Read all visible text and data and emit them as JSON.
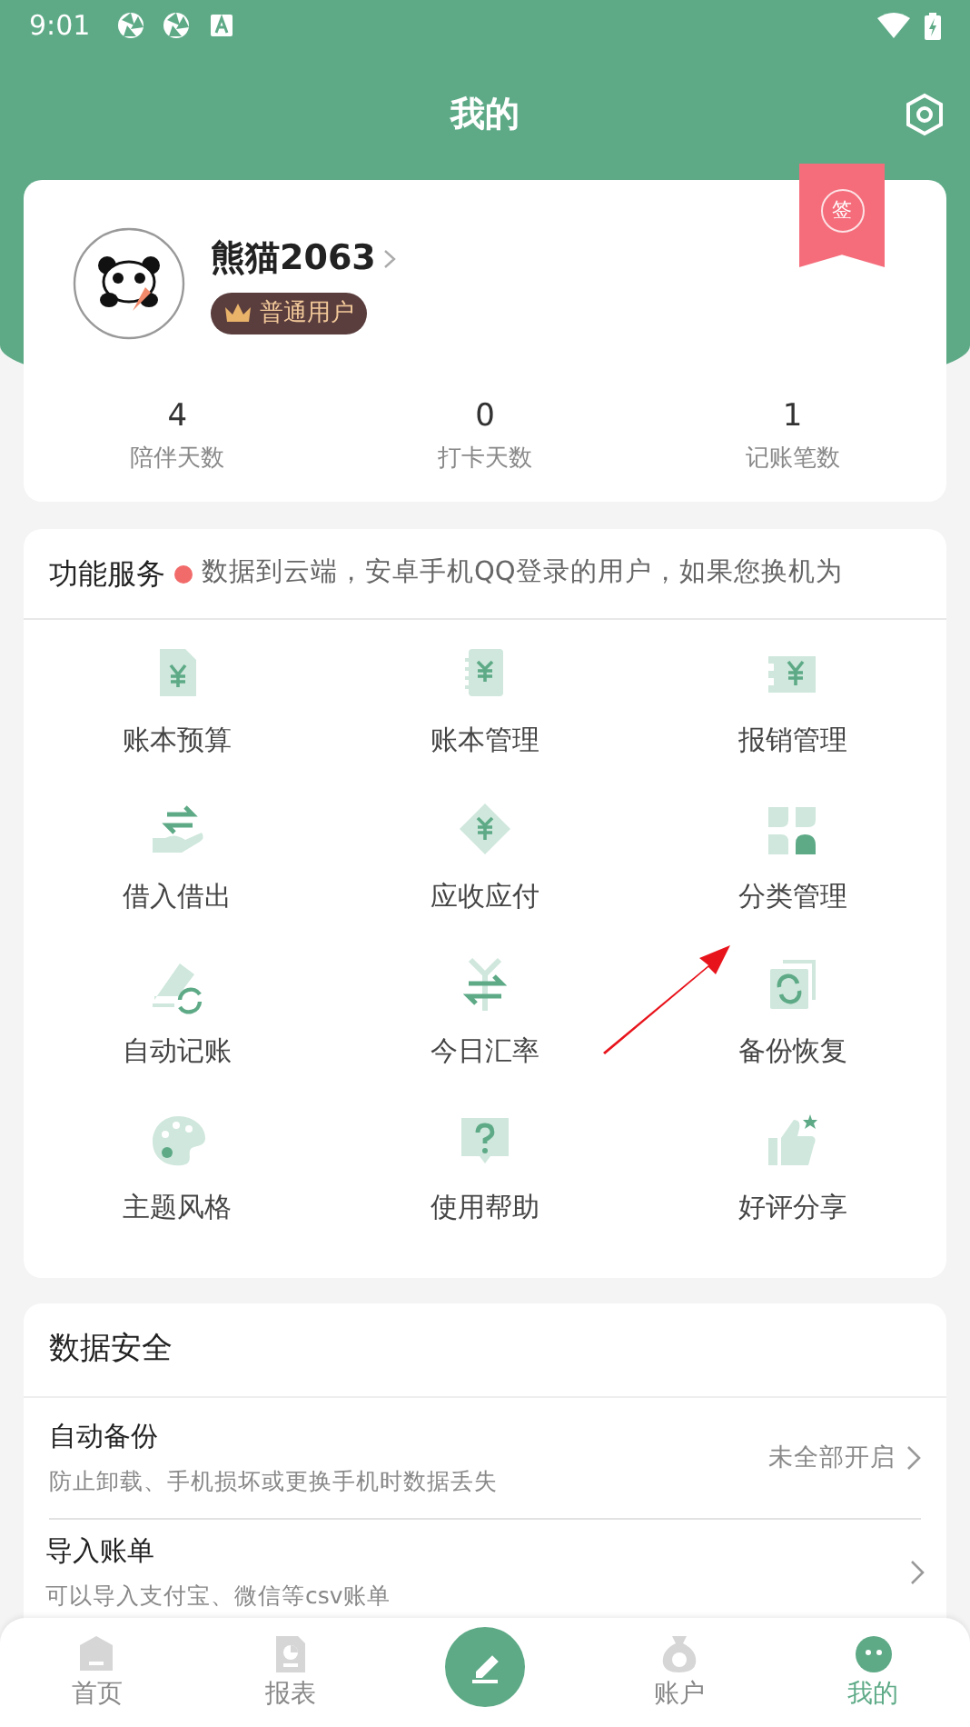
{
  "status_bar": {
    "time": "9:01"
  },
  "header": {
    "title": "我的"
  },
  "profile": {
    "name": "熊猫2063",
    "badge": "普通用户",
    "sign_label": "签",
    "stats": [
      {
        "value": "4",
        "label": "陪伴天数"
      },
      {
        "value": "0",
        "label": "打卡天数"
      },
      {
        "value": "1",
        "label": "记账笔数"
      }
    ]
  },
  "services": {
    "title": "功能服务",
    "notice": "数据到云端，安卓手机QQ登录的用户，如果您换机为",
    "items": [
      {
        "label": "账本预算"
      },
      {
        "label": "账本管理"
      },
      {
        "label": "报销管理"
      },
      {
        "label": "借入借出"
      },
      {
        "label": "应收应付"
      },
      {
        "label": "分类管理"
      },
      {
        "label": "自动记账"
      },
      {
        "label": "今日汇率"
      },
      {
        "label": "备份恢复"
      },
      {
        "label": "主题风格"
      },
      {
        "label": "使用帮助"
      },
      {
        "label": "好评分享"
      }
    ]
  },
  "data_security": {
    "title": "数据安全",
    "rows": [
      {
        "title": "自动备份",
        "subtitle": "防止卸载、手机损坏或更换手机时数据丢失",
        "value": "未全部开启"
      },
      {
        "title": "导入账单",
        "subtitle": "可以导入支付宝、微信等csv账单"
      }
    ]
  },
  "bottom_nav": [
    {
      "kind": "tab",
      "label": "首页",
      "selected": false
    },
    {
      "kind": "tab",
      "label": "报表",
      "selected": false
    },
    {
      "kind": "add"
    },
    {
      "kind": "tab",
      "label": "账户",
      "selected": false
    },
    {
      "kind": "tab",
      "label": "我的",
      "selected": true
    }
  ]
}
